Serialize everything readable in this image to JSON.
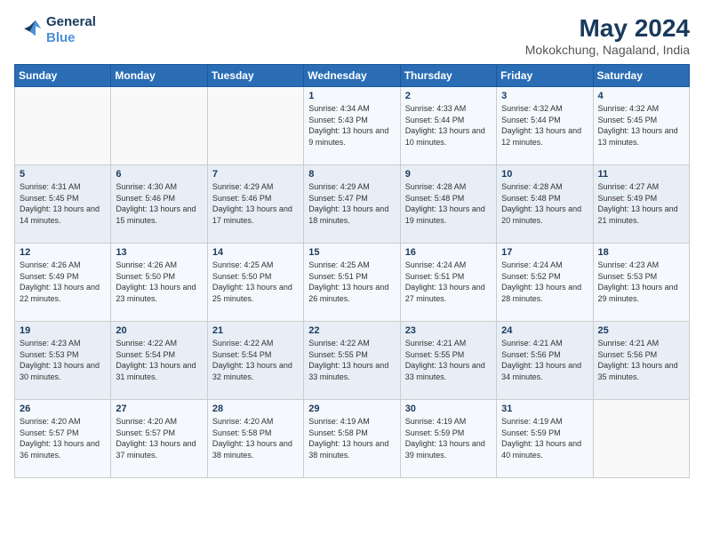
{
  "logo": {
    "line1": "General",
    "line2": "Blue"
  },
  "title": "May 2024",
  "location": "Mokokchung, Nagaland, India",
  "days_of_week": [
    "Sunday",
    "Monday",
    "Tuesday",
    "Wednesday",
    "Thursday",
    "Friday",
    "Saturday"
  ],
  "weeks": [
    [
      {
        "day": "",
        "info": ""
      },
      {
        "day": "",
        "info": ""
      },
      {
        "day": "",
        "info": ""
      },
      {
        "day": "1",
        "sunrise": "4:34 AM",
        "sunset": "5:43 PM",
        "daylight": "13 hours and 9 minutes."
      },
      {
        "day": "2",
        "sunrise": "4:33 AM",
        "sunset": "5:44 PM",
        "daylight": "13 hours and 10 minutes."
      },
      {
        "day": "3",
        "sunrise": "4:32 AM",
        "sunset": "5:44 PM",
        "daylight": "13 hours and 12 minutes."
      },
      {
        "day": "4",
        "sunrise": "4:32 AM",
        "sunset": "5:45 PM",
        "daylight": "13 hours and 13 minutes."
      }
    ],
    [
      {
        "day": "5",
        "sunrise": "4:31 AM",
        "sunset": "5:45 PM",
        "daylight": "13 hours and 14 minutes."
      },
      {
        "day": "6",
        "sunrise": "4:30 AM",
        "sunset": "5:46 PM",
        "daylight": "13 hours and 15 minutes."
      },
      {
        "day": "7",
        "sunrise": "4:29 AM",
        "sunset": "5:46 PM",
        "daylight": "13 hours and 17 minutes."
      },
      {
        "day": "8",
        "sunrise": "4:29 AM",
        "sunset": "5:47 PM",
        "daylight": "13 hours and 18 minutes."
      },
      {
        "day": "9",
        "sunrise": "4:28 AM",
        "sunset": "5:48 PM",
        "daylight": "13 hours and 19 minutes."
      },
      {
        "day": "10",
        "sunrise": "4:28 AM",
        "sunset": "5:48 PM",
        "daylight": "13 hours and 20 minutes."
      },
      {
        "day": "11",
        "sunrise": "4:27 AM",
        "sunset": "5:49 PM",
        "daylight": "13 hours and 21 minutes."
      }
    ],
    [
      {
        "day": "12",
        "sunrise": "4:26 AM",
        "sunset": "5:49 PM",
        "daylight": "13 hours and 22 minutes."
      },
      {
        "day": "13",
        "sunrise": "4:26 AM",
        "sunset": "5:50 PM",
        "daylight": "13 hours and 23 minutes."
      },
      {
        "day": "14",
        "sunrise": "4:25 AM",
        "sunset": "5:50 PM",
        "daylight": "13 hours and 25 minutes."
      },
      {
        "day": "15",
        "sunrise": "4:25 AM",
        "sunset": "5:51 PM",
        "daylight": "13 hours and 26 minutes."
      },
      {
        "day": "16",
        "sunrise": "4:24 AM",
        "sunset": "5:51 PM",
        "daylight": "13 hours and 27 minutes."
      },
      {
        "day": "17",
        "sunrise": "4:24 AM",
        "sunset": "5:52 PM",
        "daylight": "13 hours and 28 minutes."
      },
      {
        "day": "18",
        "sunrise": "4:23 AM",
        "sunset": "5:53 PM",
        "daylight": "13 hours and 29 minutes."
      }
    ],
    [
      {
        "day": "19",
        "sunrise": "4:23 AM",
        "sunset": "5:53 PM",
        "daylight": "13 hours and 30 minutes."
      },
      {
        "day": "20",
        "sunrise": "4:22 AM",
        "sunset": "5:54 PM",
        "daylight": "13 hours and 31 minutes."
      },
      {
        "day": "21",
        "sunrise": "4:22 AM",
        "sunset": "5:54 PM",
        "daylight": "13 hours and 32 minutes."
      },
      {
        "day": "22",
        "sunrise": "4:22 AM",
        "sunset": "5:55 PM",
        "daylight": "13 hours and 33 minutes."
      },
      {
        "day": "23",
        "sunrise": "4:21 AM",
        "sunset": "5:55 PM",
        "daylight": "13 hours and 33 minutes."
      },
      {
        "day": "24",
        "sunrise": "4:21 AM",
        "sunset": "5:56 PM",
        "daylight": "13 hours and 34 minutes."
      },
      {
        "day": "25",
        "sunrise": "4:21 AM",
        "sunset": "5:56 PM",
        "daylight": "13 hours and 35 minutes."
      }
    ],
    [
      {
        "day": "26",
        "sunrise": "4:20 AM",
        "sunset": "5:57 PM",
        "daylight": "13 hours and 36 minutes."
      },
      {
        "day": "27",
        "sunrise": "4:20 AM",
        "sunset": "5:57 PM",
        "daylight": "13 hours and 37 minutes."
      },
      {
        "day": "28",
        "sunrise": "4:20 AM",
        "sunset": "5:58 PM",
        "daylight": "13 hours and 38 minutes."
      },
      {
        "day": "29",
        "sunrise": "4:19 AM",
        "sunset": "5:58 PM",
        "daylight": "13 hours and 38 minutes."
      },
      {
        "day": "30",
        "sunrise": "4:19 AM",
        "sunset": "5:59 PM",
        "daylight": "13 hours and 39 minutes."
      },
      {
        "day": "31",
        "sunrise": "4:19 AM",
        "sunset": "5:59 PM",
        "daylight": "13 hours and 40 minutes."
      },
      {
        "day": "",
        "info": ""
      }
    ]
  ]
}
